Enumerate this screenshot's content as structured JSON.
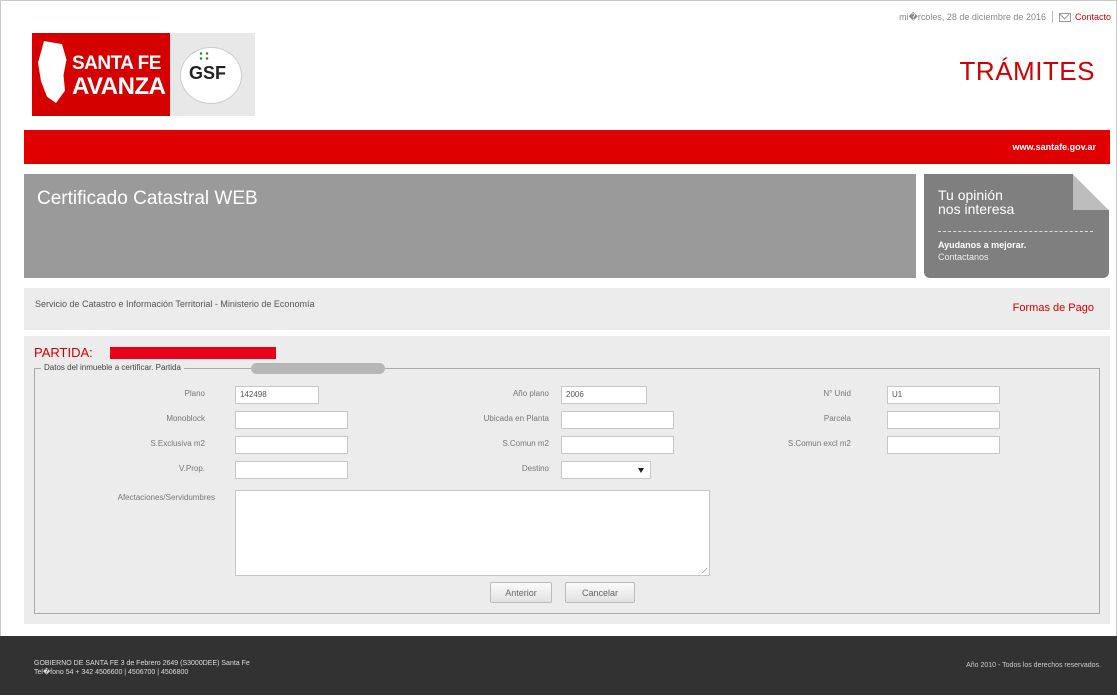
{
  "topbar": {
    "date": "mi�rcoles, 28 de diciembre de 2016",
    "contact": "Contacto"
  },
  "logos": {
    "santafe_line1": "SANTA FE",
    "santafe_line2": "AVANZA",
    "gsf": "GSF"
  },
  "header": {
    "tramites": "TRÁMITES"
  },
  "redbar": {
    "url": "www.santafe.gov.ar"
  },
  "banner": {
    "title": "Certificado Catastral WEB"
  },
  "opinion": {
    "line1": "Tu opinión",
    "line2": "nos interesa",
    "line3": "Ayudanos a mejorar.",
    "line4": "Contactanos"
  },
  "strip": {
    "service": "Servicio de Catastro e Información Territorial - Ministerio de Economía",
    "pago": "Formas de Pago"
  },
  "form": {
    "partida_label": "PARTIDA:",
    "legend": "Datos del inmueble a certificar. Partida",
    "fields": {
      "plano": {
        "label": "Plano",
        "value": "142498"
      },
      "anio_plano": {
        "label": "Año plano",
        "value": "2006"
      },
      "n_unid": {
        "label": "N° Unid",
        "value": "U1"
      },
      "monoblock": {
        "label": "Monoblock",
        "value": ""
      },
      "ubicada_planta": {
        "label": "Ubicada en Planta",
        "value": ""
      },
      "parcela": {
        "label": "Parcela",
        "value": ""
      },
      "s_exclusiva": {
        "label": "S.Exclusiva m2",
        "value": ""
      },
      "s_comun": {
        "label": "S.Comun m2",
        "value": ""
      },
      "s_comun_excl": {
        "label": "S.Comun excl m2",
        "value": ""
      },
      "v_prop": {
        "label": "V.Prop.",
        "value": ""
      },
      "destino": {
        "label": "Destino",
        "value": ""
      },
      "afectaciones": {
        "label": "Afectaciones/Servidumbres",
        "value": ""
      }
    },
    "buttons": {
      "anterior": "Anterior",
      "cancelar": "Cancelar"
    }
  },
  "footer": {
    "address_line1": "GOBIERNO DE SANTA FE 3 de Febrero 2649 (S3000DEE) Santa Fe",
    "address_line2": "Tel�fono 54 + 342 4506600 | 4506700 | 4506800",
    "rights": "Año 2010 - Todos los derechos reservados."
  }
}
